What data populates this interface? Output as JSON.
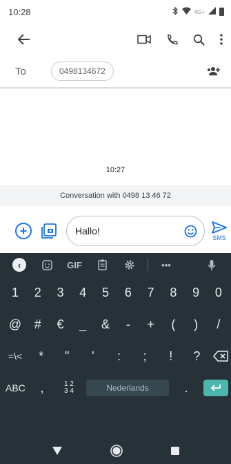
{
  "status_bar": {
    "time": "10:28",
    "network": "4G+"
  },
  "recipient": {
    "to_label": "To",
    "number": "0498134672"
  },
  "conversation": {
    "timestamp": "10:27",
    "banner": "Conversation with 0498 13 46 72"
  },
  "compose": {
    "text": "Hallo!",
    "send_label": "SMS"
  },
  "keyboard": {
    "toolbar": {
      "gif": "GIF",
      "more": "•••"
    },
    "row1": [
      "1",
      "2",
      "3",
      "4",
      "5",
      "6",
      "7",
      "8",
      "9",
      "0"
    ],
    "row2": [
      "@",
      "#",
      "€",
      "_",
      "&",
      "-",
      "+",
      "(",
      ")",
      "/"
    ],
    "row3": [
      "=\\<",
      "*",
      "\"",
      "'",
      ":",
      ";",
      "!",
      "?"
    ],
    "bottom": {
      "abc": "ABC",
      "comma": ",",
      "fraction_top": "1 2",
      "fraction_bottom": "3 4",
      "space_label": "Nederlands",
      "period": "."
    }
  },
  "colors": {
    "accent": "#1a73e8",
    "keyboard_bg": "#263238",
    "enter": "#4db6ac"
  }
}
